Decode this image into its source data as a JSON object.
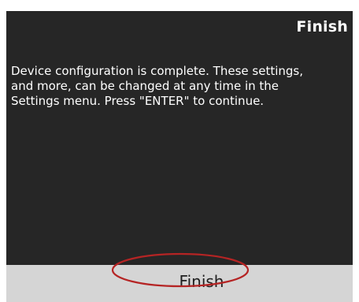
{
  "header": {
    "title": "Finish"
  },
  "message": {
    "lines": [
      "Device configuration is complete. These settings,",
      "and more, can be changed at any time in the",
      "Settings menu. Press \"ENTER\" to continue."
    ]
  },
  "soft_keys": {
    "finish_label": "Finish"
  },
  "colors": {
    "screen_background": "#262626",
    "soft_key_bar": "#d5d5d5",
    "highlight": "#b52424"
  }
}
